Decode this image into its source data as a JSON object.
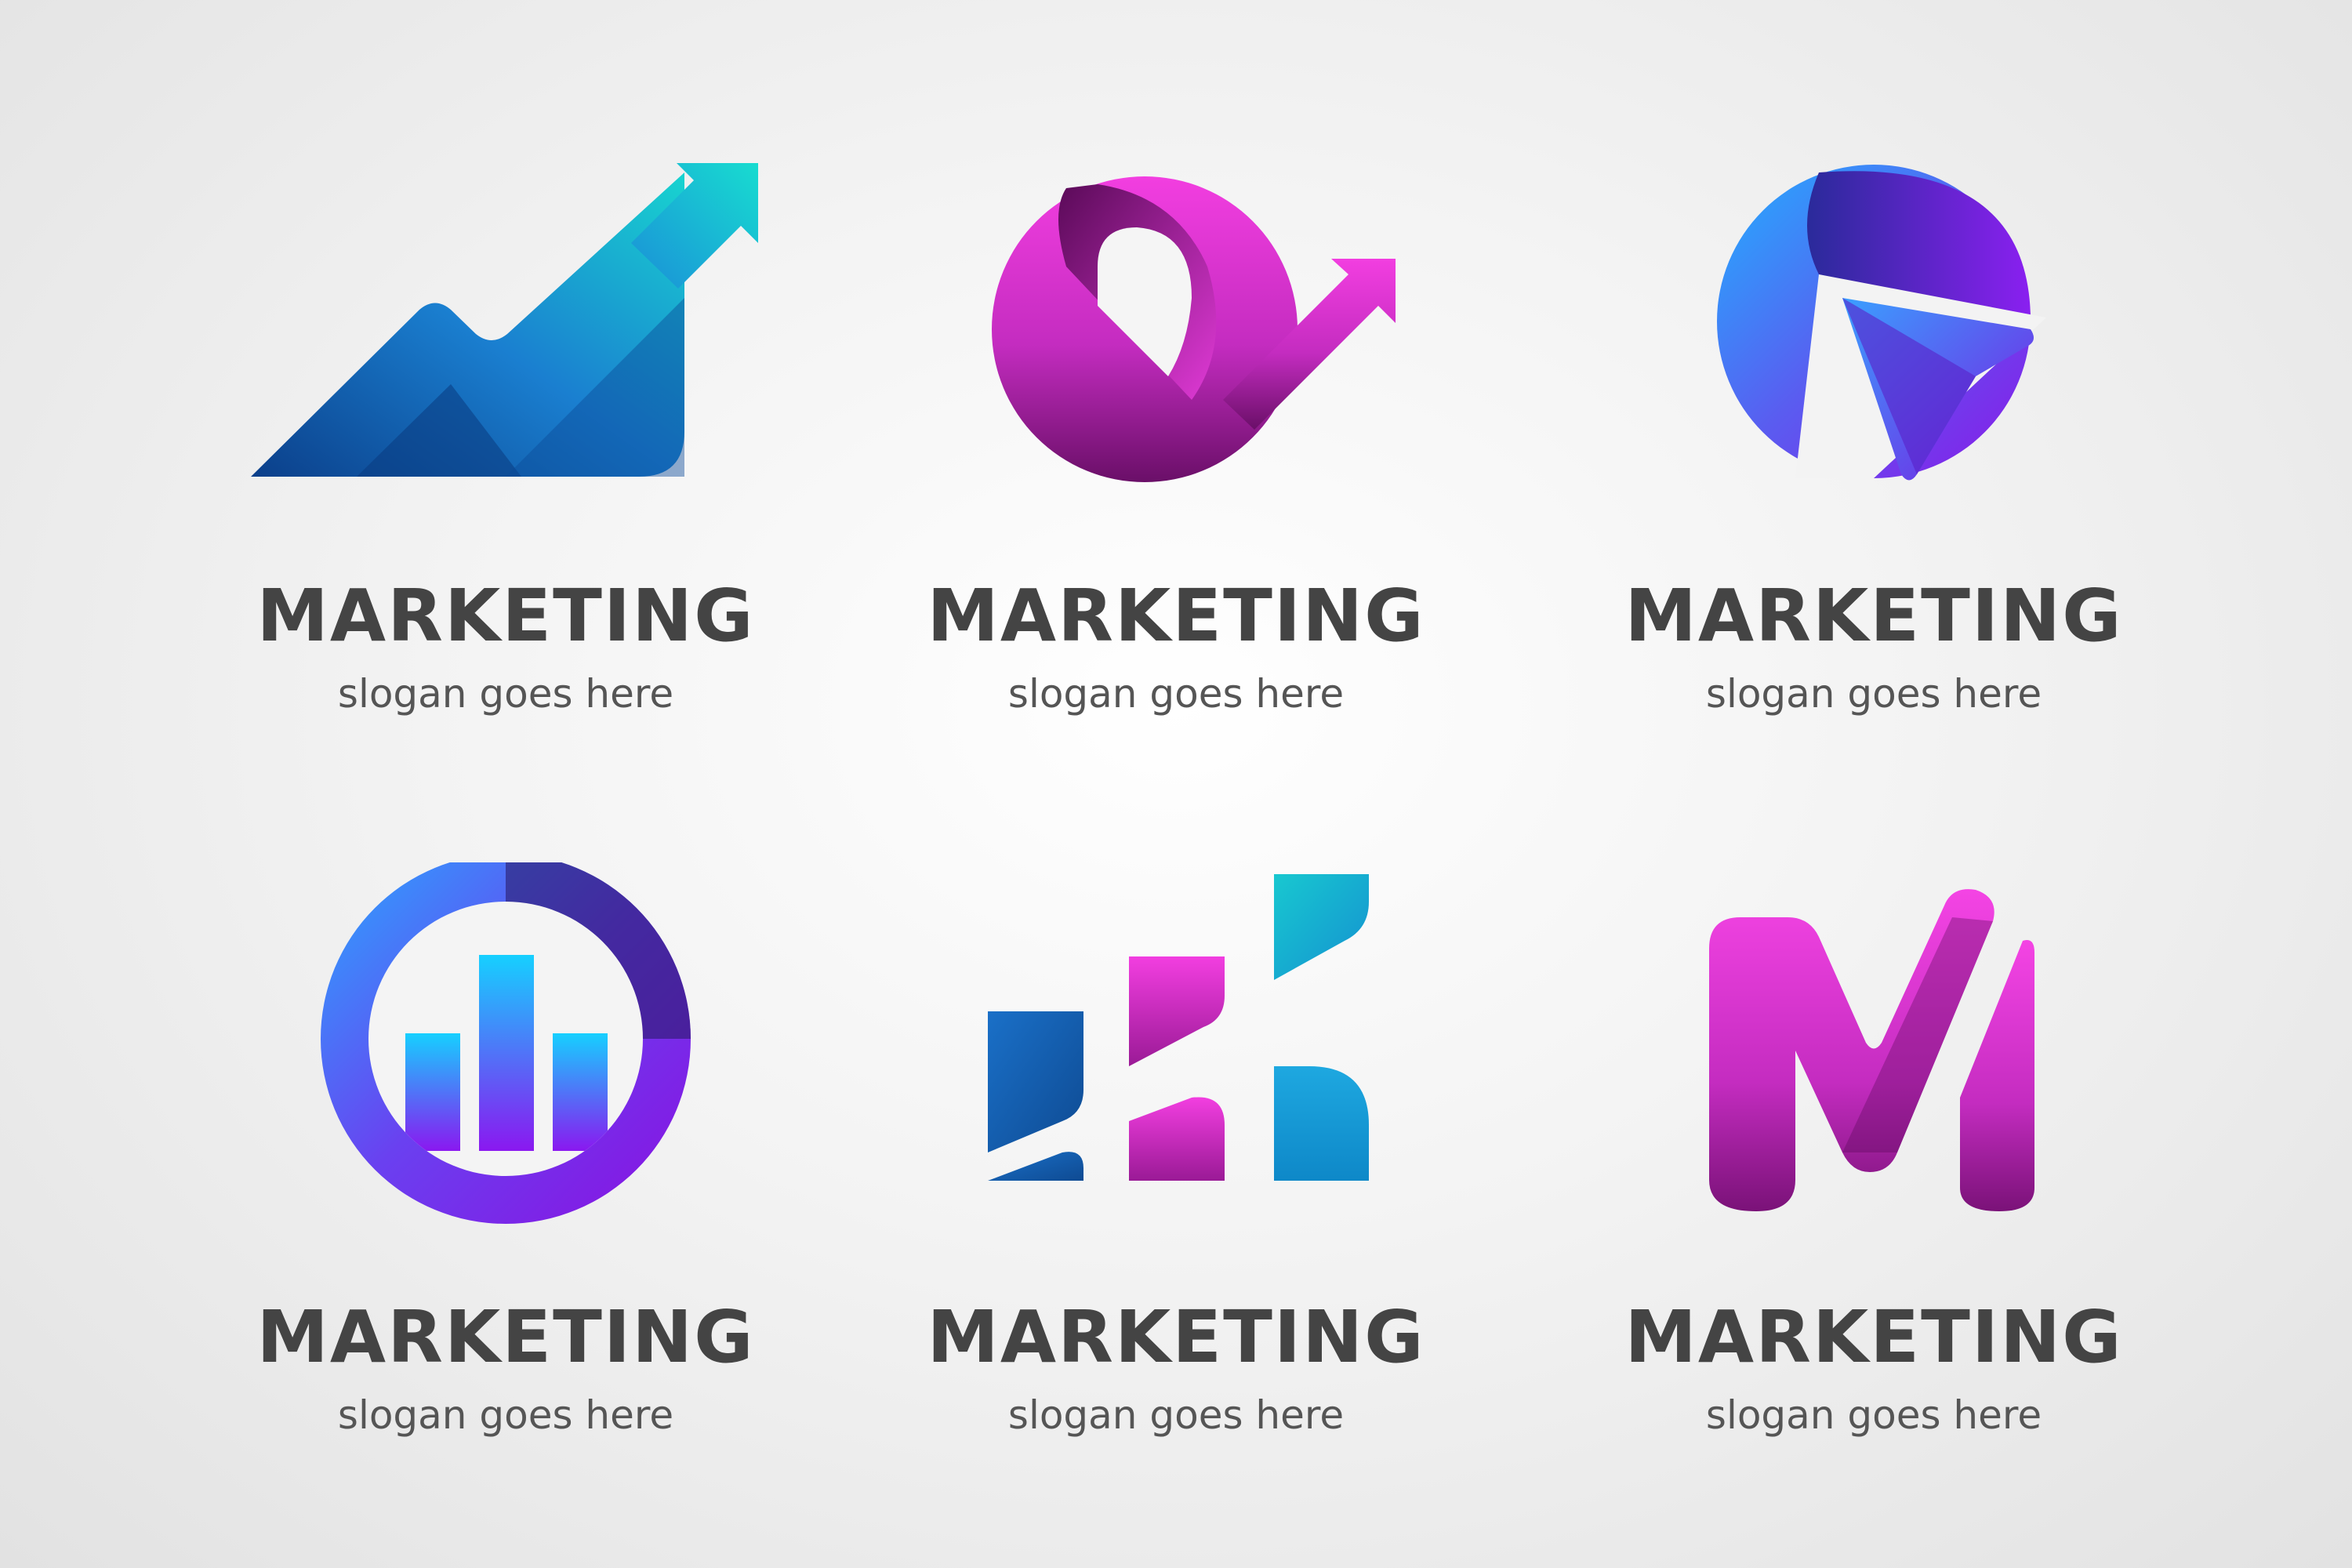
{
  "logos": [
    {
      "name": "MARKETING",
      "slogan": "slogan goes here",
      "icon": "rising-arrow-chart-icon"
    },
    {
      "name": "MARKETING",
      "slogan": "slogan goes here",
      "icon": "circle-arrow-icon"
    },
    {
      "name": "MARKETING",
      "slogan": "slogan goes here",
      "icon": "paper-plane-circle-icon"
    },
    {
      "name": "MARKETING",
      "slogan": "slogan goes here",
      "icon": "bar-chart-ring-icon"
    },
    {
      "name": "MARKETING",
      "slogan": "slogan goes here",
      "icon": "stepped-blocks-icon"
    },
    {
      "name": "MARKETING",
      "slogan": "slogan goes here",
      "icon": "letter-m-icon"
    }
  ],
  "colors": {
    "blue": "#1a6fc0",
    "teal": "#18d4d0",
    "magenta": "#f23ee0",
    "violet": "#8a18e8",
    "cyan": "#1ac8ff",
    "text": "#444444"
  }
}
